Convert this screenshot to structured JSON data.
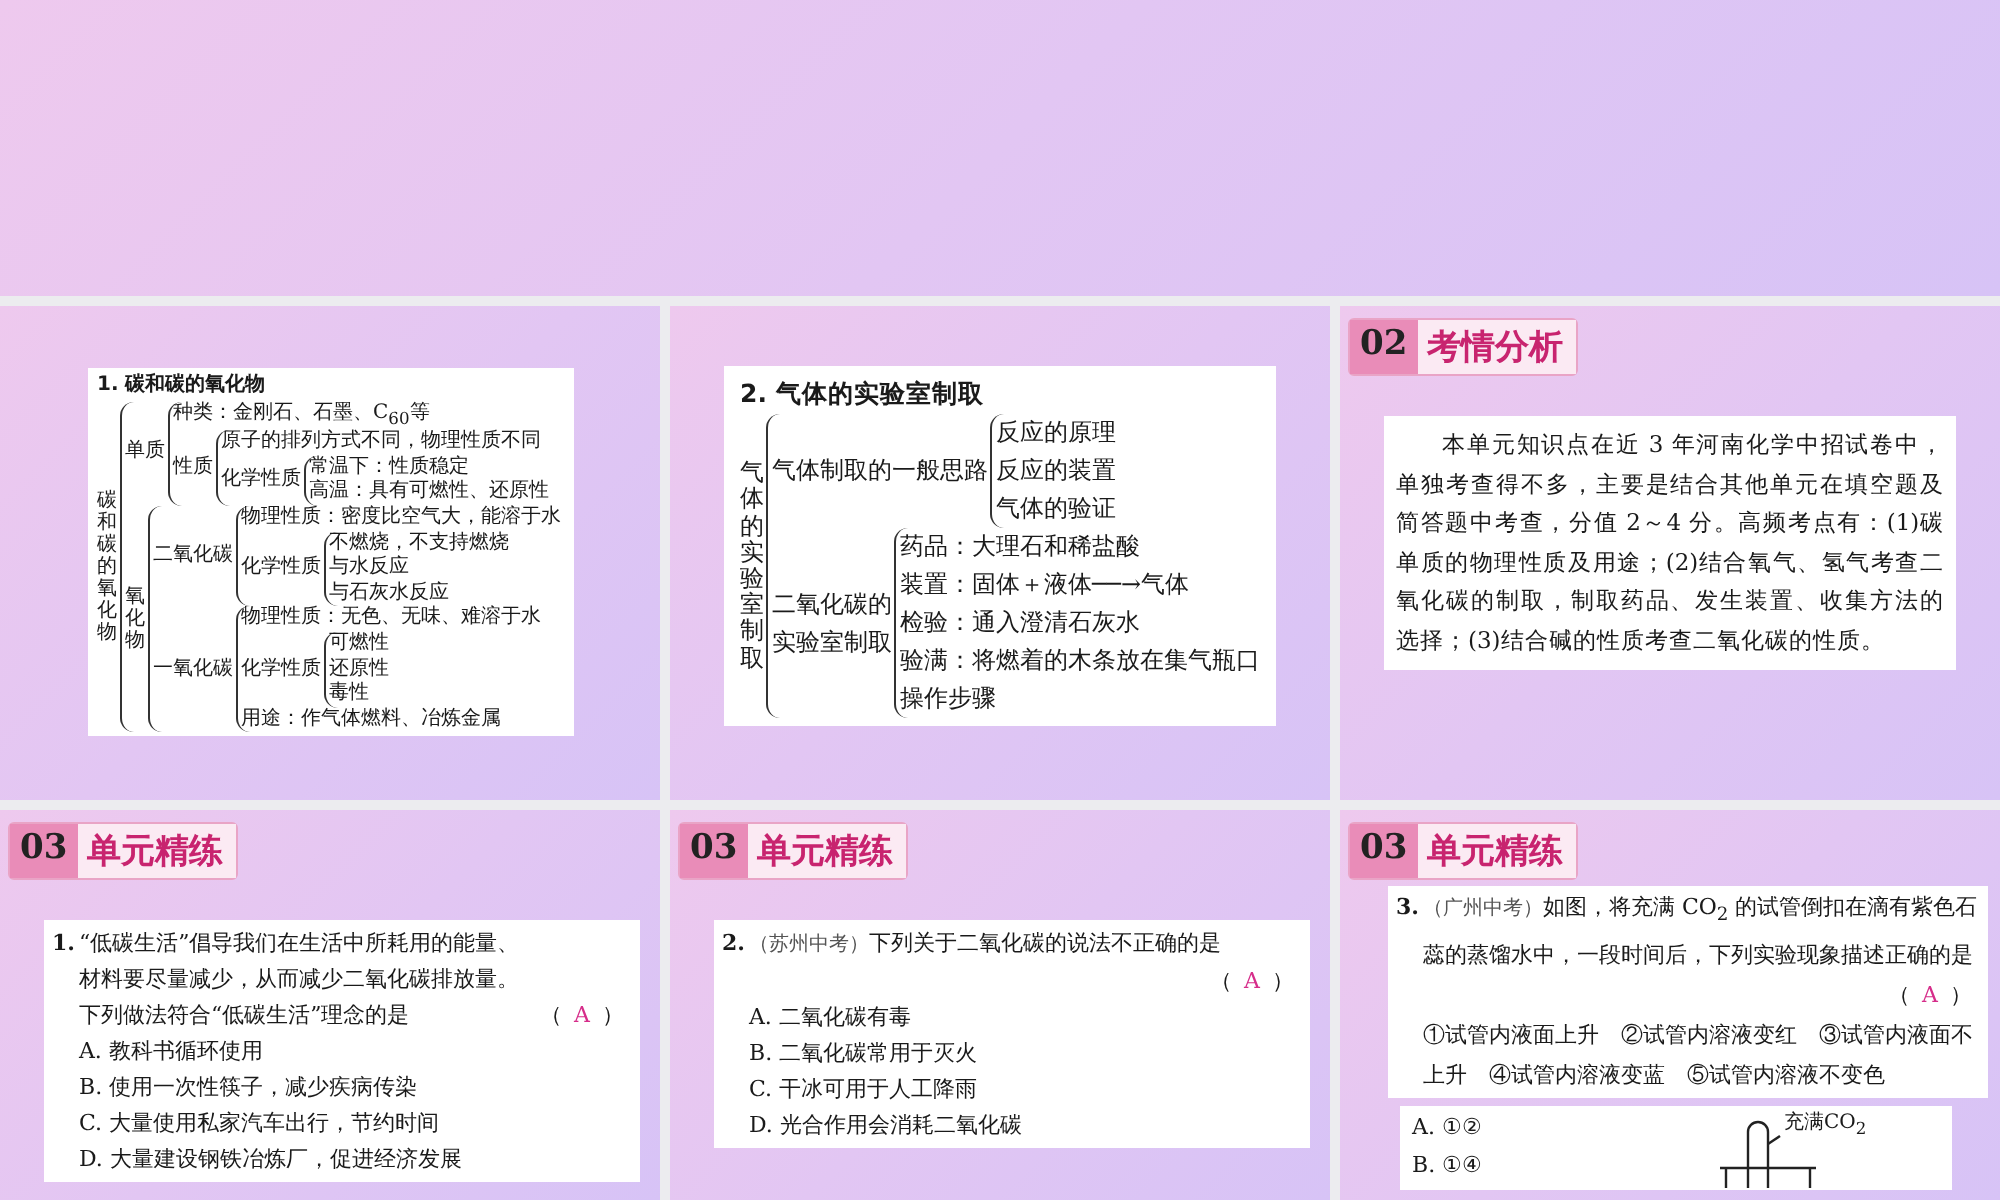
{
  "slides": [
    {
      "kind": "blank"
    },
    {
      "kind": "diagram",
      "title": "1. 碳和碳的氧化物",
      "tree": {
        "label": [
          "碳和碳的氧化物"
        ],
        "vertical": true,
        "children": [
          {
            "label": [
              "单质"
            ],
            "children": [
              {
                "label": [
                  "种类：金刚石、石墨、C$_{60}$等"
                ]
              },
              {
                "label": [
                  "性质"
                ],
                "children": [
                  {
                    "label": [
                      "原子的排列方式不同，物理性质不同"
                    ]
                  },
                  {
                    "label": [
                      "化学性质"
                    ],
                    "children": [
                      {
                        "label": [
                          "常温下：性质稳定"
                        ]
                      },
                      {
                        "label": [
                          "高温：具有可燃性、还原性"
                        ]
                      }
                    ]
                  }
                ]
              }
            ]
          },
          {
            "label": [
              "氧化物"
            ],
            "vertical": true,
            "children": [
              {
                "label": [
                  "二氧化碳"
                ],
                "children": [
                  {
                    "label": [
                      "物理性质：密度比空气大，能溶于水"
                    ]
                  },
                  {
                    "label": [
                      "化学性质"
                    ],
                    "children": [
                      {
                        "label": [
                          "不燃烧，不支持燃烧"
                        ]
                      },
                      {
                        "label": [
                          "与水反应"
                        ]
                      },
                      {
                        "label": [
                          "与石灰水反应"
                        ]
                      }
                    ]
                  }
                ]
              },
              {
                "label": [
                  "一氧化碳"
                ],
                "children": [
                  {
                    "label": [
                      "物理性质：无色、无味、难溶于水"
                    ]
                  },
                  {
                    "label": [
                      "化学性质"
                    ],
                    "children": [
                      {
                        "label": [
                          "可燃性"
                        ]
                      },
                      {
                        "label": [
                          "还原性"
                        ]
                      },
                      {
                        "label": [
                          "毒性"
                        ]
                      }
                    ]
                  },
                  {
                    "label": [
                      "用途：作气体燃料、冶炼金属"
                    ]
                  }
                ]
              }
            ]
          }
        ]
      }
    },
    {
      "kind": "diagram",
      "title": "2. 气体的实验室制取",
      "tree": {
        "label": [
          "气体的实验室制取"
        ],
        "vertical": true,
        "children": [
          {
            "label": [
              "气体制取的一般思路"
            ],
            "children": [
              {
                "label": [
                  "反应的原理"
                ]
              },
              {
                "label": [
                  "反应的装置"
                ]
              },
              {
                "label": [
                  "气体的验证"
                ]
              }
            ]
          },
          {
            "label": [
              "二氧化碳的",
              "实验室制取"
            ],
            "children": [
              {
                "label": [
                  "药品：大理石和稀盐酸"
                ]
              },
              {
                "label": [
                  "装置：固体＋液体──→气体"
                ]
              },
              {
                "label": [
                  "检验：通入澄清石灰水"
                ]
              },
              {
                "label": [
                  "验满：将燃着的木条放在集气瓶口"
                ]
              },
              {
                "label": [
                  "操作步骤"
                ]
              }
            ]
          }
        ]
      }
    },
    {
      "kind": "analysis",
      "badge": "02",
      "heading": "考情分析",
      "text": "本单元知识点在近 3 年河南化学中招试卷中，单独考查得不多，主要是结合其他单元在填空题及简答题中考查，分值 2～4 分。高频考点有：(1)碳单质的物理性质及用途；(2)结合氧气、氢气考查二氧化碳的制取，制取药品、发生装置、收集方法的选择；(3)结合碱的性质考查二氧化碳的性质。"
    },
    {
      "kind": "question",
      "badge": "03",
      "heading": "单元精练",
      "number": "1.",
      "question": "“低碳生活”倡导我们在生活中所耗用的能量、材料要尽量减少，从而减少二氧化碳排放量。下列做法符合“低碳生活”理念的是",
      "bracket_left": "（",
      "answer": "A",
      "bracket_right": "）",
      "options": [
        "A. 教科书循环使用",
        "B. 使用一次性筷子，减少疾病传染",
        "C. 大量使用私家汽车出行，节约时间",
        "D. 大量建设钢铁冶炼厂，促进经济发展"
      ]
    },
    {
      "kind": "question",
      "badge": "03",
      "heading": "单元精练",
      "number": "2.",
      "source": "（苏州中考）",
      "question": "下列关于二氧化碳的说法不正确的是",
      "bracket_left": "（",
      "answer": "A",
      "bracket_right": "）",
      "answer_newline": true,
      "options": [
        "A. 二氧化碳有毒",
        "B. 二氧化碳常用于灭火",
        "C. 干冰可用于人工降雨",
        "D. 光合作用会消耗二氧化碳"
      ]
    },
    {
      "kind": "question",
      "badge": "03",
      "heading": "单元精练",
      "number": "3.",
      "source": "（广州中考）",
      "question": "如图，将充满 CO$_{2}$ 的试管倒扣在滴有紫色石蕊的蒸馏水中，一段时间后，下列实验现象描述正确的是",
      "bracket_left": "（",
      "answer": "A",
      "bracket_right": "）",
      "answer_newline": true,
      "statements": "①试管内液面上升　②试管内溶液变红　③试管内液面不上升　④试管内溶液变蓝　⑤试管内溶液不变色",
      "options": [
        "A. ①②",
        "B. ①④"
      ],
      "figure_label": "充满CO$_{2}$"
    }
  ]
}
